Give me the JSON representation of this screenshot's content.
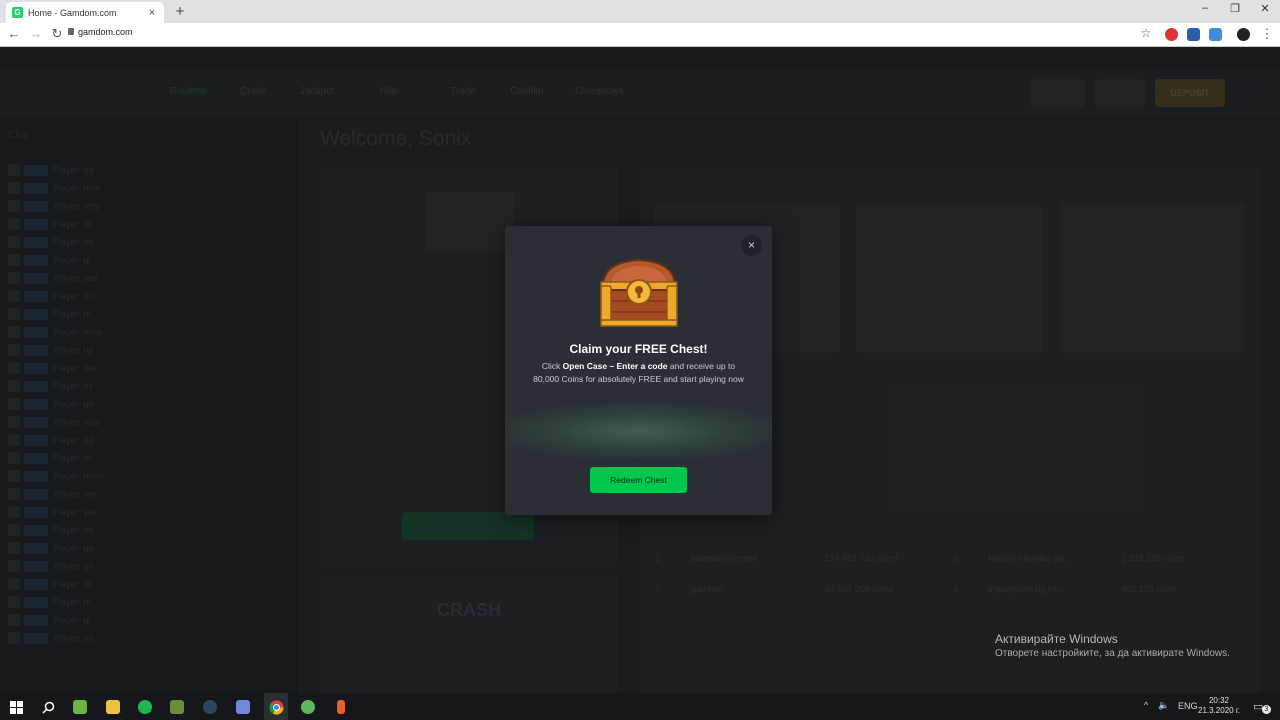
{
  "browser": {
    "tab_title": "Home - Gamdom.com",
    "tab_favicon_letter": "G",
    "new_tab_symbol": "+",
    "tab_close_symbol": "×",
    "url": "gamdom.com",
    "window_controls": [
      "–",
      "❐",
      "✕"
    ],
    "nav": [
      "←",
      "→",
      "↻"
    ]
  },
  "site": {
    "welcome": "Welcome, Sonix",
    "nav_links": [
      "Roulette",
      "Crash",
      "Jackpot",
      "Hilo",
      "Trade",
      "Coinflip",
      "Giveaways"
    ],
    "deposit_label": "DEPOSIT",
    "crash_label": "CRASH",
    "chat_header": "Chat",
    "chat_rows": [
      "Player: gg",
      "Player: nice",
      "Player: why",
      "Player: lol",
      "Player: ok",
      "Player: gl",
      "Player: yes",
      "Player: no",
      "Player: hi",
      "Player: wow",
      "Player: rip",
      "Player: bet",
      "Player: ez",
      "Player: go",
      "Player: nice",
      "Player: gg",
      "Player: lol",
      "Player: hmm",
      "Player: win",
      "Player: yes",
      "Player: ok",
      "Player: gg",
      "Player: go",
      "Player: lol",
      "Player: hi",
      "Player: gl",
      "Player: ez"
    ],
    "table_rows": [
      [
        "2",
        "tatlarsantrhonaw",
        "114 663 733 coins",
        "3",
        "Madrid Alkwaks ga...",
        "1 319 238 coins"
      ],
      [
        "3",
        "gambler",
        "64 507 009 coins",
        "4",
        "tryeuphoria ng ks...",
        "963 173 coins"
      ]
    ]
  },
  "modal": {
    "close_symbol": "×",
    "title": "Claim your FREE Chest!",
    "body_prefix": "Click ",
    "body_bold": "Open Case – Enter a code",
    "body_suffix": " and receive up to 80,000 Coins for absolutely FREE and start playing now",
    "button_label": "Redeem Chest",
    "accent": "#00c74d"
  },
  "watermark": {
    "line1": "Активирайте Windows",
    "line2": "Отворете настройките, за да активирате Windows."
  },
  "taskbar": {
    "lang": "ENG",
    "time": "20:32",
    "date": "21.3.2020 г.",
    "notification_count": "3"
  }
}
